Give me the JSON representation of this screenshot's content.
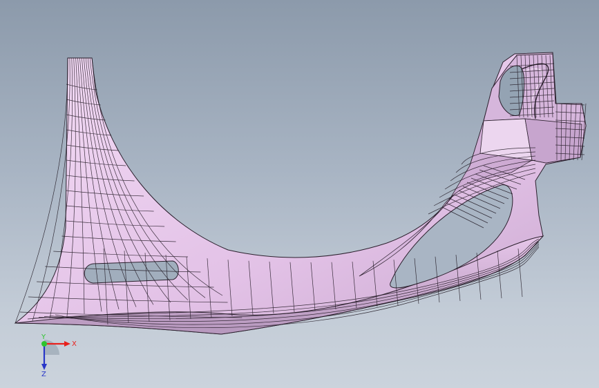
{
  "viewport": {
    "background_top": "#8c9aab",
    "background_bottom": "#cbd3dc"
  },
  "model": {
    "surface_color": "#e7c8ea",
    "shade_color": "#a88fb0",
    "mesh_color": "#1c141e"
  },
  "triad": {
    "x_label": "X",
    "y_label": "Y",
    "z_label": "Z",
    "x_color": "#e8201c",
    "y_color": "#2ec52e",
    "z_color": "#2735c8"
  }
}
